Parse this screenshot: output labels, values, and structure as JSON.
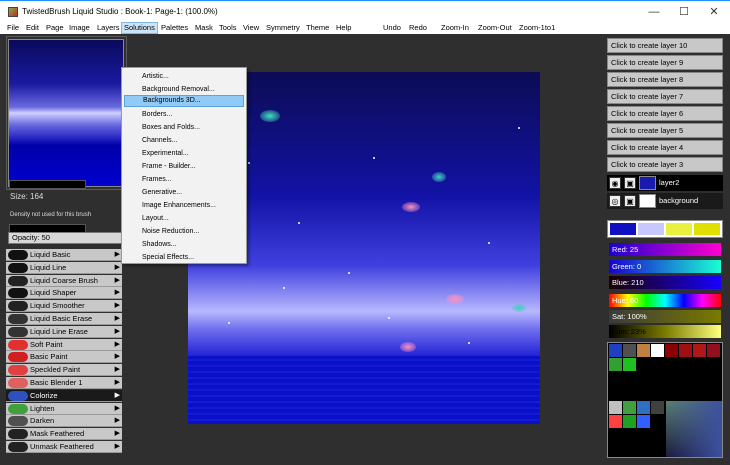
{
  "window": {
    "title": "TwistedBrush Liquid Studio : Book-1: Page-1:  (100.0%)",
    "minimize": "—",
    "maximize": "☐",
    "close": "✕"
  },
  "menu": [
    "File",
    "Edit",
    "Page",
    "Image",
    "Layers",
    "Solutions",
    "Palettes",
    "Mask",
    "Tools",
    "View",
    "Symmetry",
    "Theme",
    "Help",
    "Undo",
    "Redo",
    "Zoom-In",
    "Zoom-Out",
    "Zoom-1to1"
  ],
  "solutions_menu": [
    "Artistic...",
    "Background Removal...",
    "Backgrounds 3D...",
    "Borders...",
    "Boxes and Folds...",
    "Channels...",
    "Experimental...",
    "Frame - Builder...",
    "Frames...",
    "Generative...",
    "Image Enhancements...",
    "Layout...",
    "Noise Reduction...",
    "Shadows...",
    "Special Effects..."
  ],
  "solutions_highlighted": "Backgrounds 3D...",
  "brush_panel": {
    "size_label": "Size: 164",
    "density_label": "Density not used for this brush",
    "opacity_label": "Opacity: 50"
  },
  "brushes": [
    {
      "label": "Liquid Basic",
      "icon": "#111111"
    },
    {
      "label": "Liquid Line",
      "icon": "#111111"
    },
    {
      "label": "Liquid Coarse Brush",
      "icon": "#222222"
    },
    {
      "label": "Liquid Shaper",
      "icon": "#111111"
    },
    {
      "label": "Liquid Smoother",
      "icon": "#222222"
    },
    {
      "label": "Liquid Basic Erase",
      "icon": "#333333"
    },
    {
      "label": "Liquid Line Erase",
      "icon": "#333333"
    },
    {
      "label": "Soft Paint",
      "icon": "#e03030"
    },
    {
      "label": "Basic Paint",
      "icon": "#d02020"
    },
    {
      "label": "Speckled Paint",
      "icon": "#e04040"
    },
    {
      "label": "Basic Blender 1",
      "icon": "#e06060"
    },
    {
      "label": "Colorize",
      "icon": "#3050c0",
      "selected": true
    },
    {
      "label": "Lighten",
      "icon": "#40a040"
    },
    {
      "label": "Darken",
      "icon": "#505050"
    },
    {
      "label": "Mask Feathered",
      "icon": "#222222"
    },
    {
      "label": "Unmask Feathered",
      "icon": "#222222"
    }
  ],
  "layers": {
    "empty": [
      "Click to create layer 10",
      "Click to create layer 9",
      "Click to create layer 8",
      "Click to create layer 7",
      "Click to create layer 6",
      "Click to create layer 5",
      "Click to create layer 4",
      "Click to create layer 3"
    ],
    "active": [
      {
        "name": "layer2",
        "thumb": "#1a1ab0"
      },
      {
        "name": "background",
        "thumb": "#ffffff"
      }
    ]
  },
  "swatch_colors": [
    "#1010c0",
    "#c8c8ff",
    "#e8f040",
    "#e0e000"
  ],
  "sliders": {
    "red": "Red: 25",
    "green": "Green: 0",
    "blue": "Blue: 210",
    "hue": "Hue: 60",
    "sat": "Sat: 100%",
    "lum": "Lum: 23%"
  },
  "palette_colors": [
    "#2040c0",
    "#505050",
    "#c08040",
    "#ffffff",
    "#8b0000",
    "#a01010",
    "#b01818",
    "#901020",
    "#30a030",
    "#20c020",
    "#ffffff",
    "#a0a0a0",
    "#40a040",
    "#3070c0",
    "#404040",
    "#ff4040",
    "#20a020",
    "#3060ff",
    "#c0c0c0"
  ]
}
